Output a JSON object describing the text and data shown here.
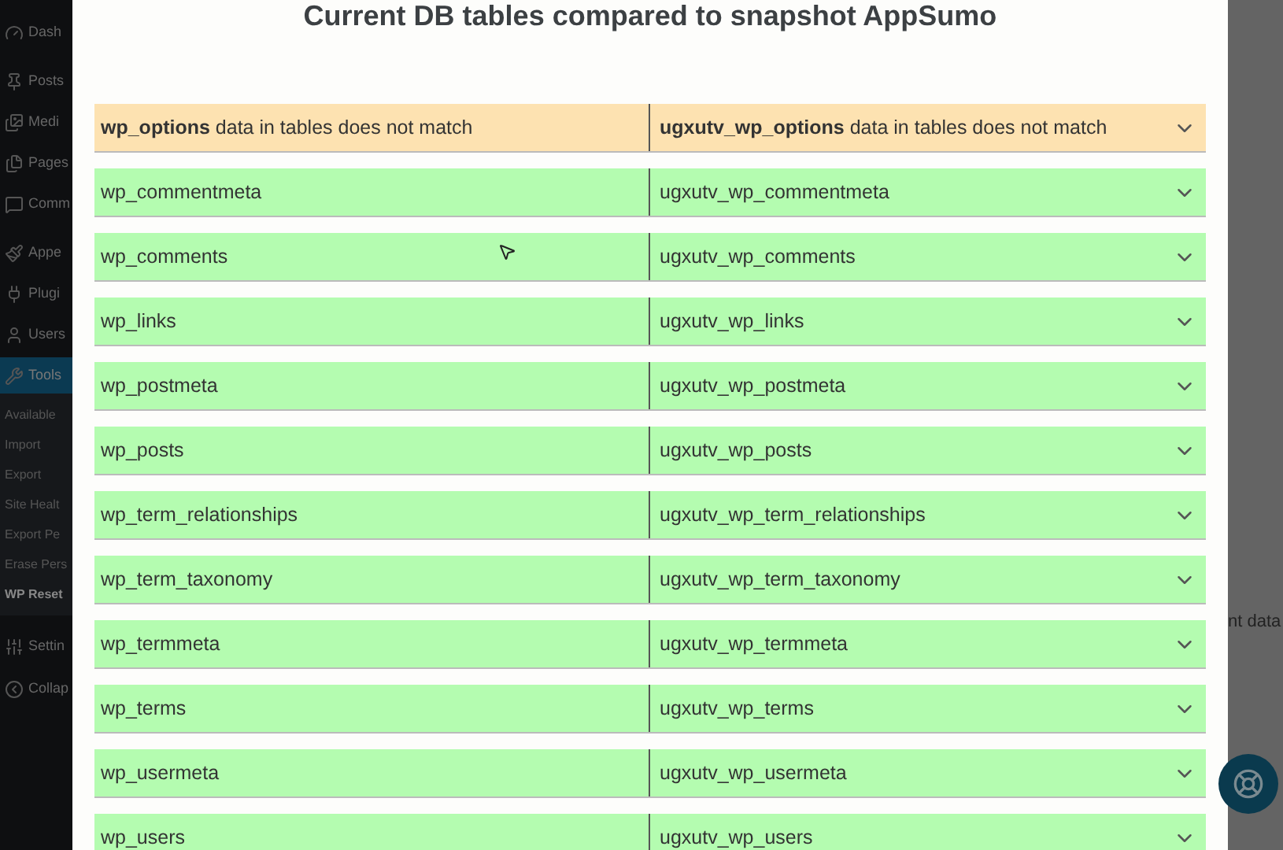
{
  "sidebar": {
    "items": [
      {
        "label": "Dash",
        "selected": false
      },
      {
        "label": "Posts",
        "selected": false
      },
      {
        "label": "Medi",
        "selected": false
      },
      {
        "label": "Pages",
        "selected": false
      },
      {
        "label": "Comm",
        "selected": false
      },
      {
        "label": "Appe",
        "selected": false
      },
      {
        "label": "Plugi",
        "selected": false
      },
      {
        "label": "Users",
        "selected": false
      },
      {
        "label": "Tools",
        "selected": true
      }
    ],
    "submenu": [
      {
        "label": "Available",
        "selected": false
      },
      {
        "label": "Import",
        "selected": false
      },
      {
        "label": "Export",
        "selected": false
      },
      {
        "label": "Site Healt",
        "selected": false
      },
      {
        "label": "Export Pe",
        "selected": false
      },
      {
        "label": "Erase Pers",
        "selected": false
      },
      {
        "label": "WP Reset",
        "selected": true
      }
    ],
    "bottom_items": [
      {
        "label": "Settin"
      },
      {
        "label": "Collap"
      }
    ]
  },
  "modal": {
    "title": "Current DB tables compared to snapshot AppSumo",
    "rows": [
      {
        "kind": "mismatch",
        "current": "**wp_options** data in tables does not match",
        "snapshot": "**ugxutv_wp_options** data in tables does not match"
      },
      {
        "kind": "match",
        "current": "wp_commentmeta",
        "snapshot": "ugxutv_wp_commentmeta"
      },
      {
        "kind": "match",
        "current": "wp_comments",
        "snapshot": "ugxutv_wp_comments"
      },
      {
        "kind": "match",
        "current": "wp_links",
        "snapshot": "ugxutv_wp_links"
      },
      {
        "kind": "match",
        "current": "wp_postmeta",
        "snapshot": "ugxutv_wp_postmeta"
      },
      {
        "kind": "match",
        "current": "wp_posts",
        "snapshot": "ugxutv_wp_posts"
      },
      {
        "kind": "match",
        "current": "wp_term_relationships",
        "snapshot": "ugxutv_wp_term_relationships"
      },
      {
        "kind": "match",
        "current": "wp_term_taxonomy",
        "snapshot": "ugxutv_wp_term_taxonomy"
      },
      {
        "kind": "match",
        "current": "wp_termmeta",
        "snapshot": "ugxutv_wp_termmeta"
      },
      {
        "kind": "match",
        "current": "wp_terms",
        "snapshot": "ugxutv_wp_terms"
      },
      {
        "kind": "match",
        "current": "wp_usermeta",
        "snapshot": "ugxutv_wp_usermeta"
      },
      {
        "kind": "match",
        "current": "wp_users",
        "snapshot": "ugxutv_wp_users"
      }
    ]
  },
  "background": {
    "text": "nt data"
  }
}
